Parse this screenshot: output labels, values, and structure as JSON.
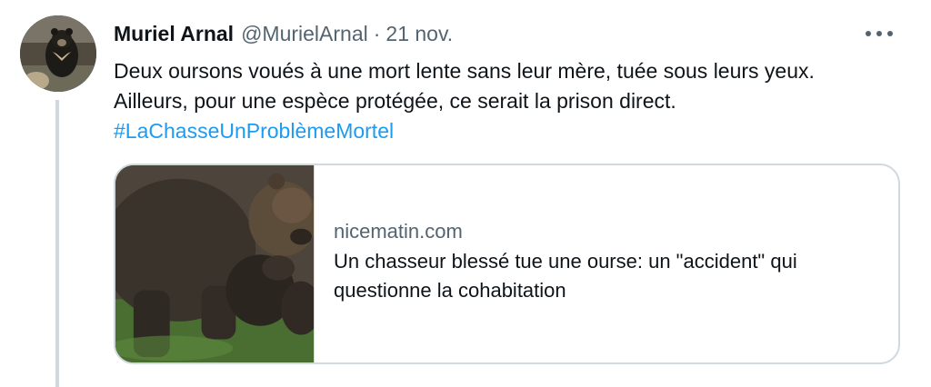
{
  "tweet": {
    "author_name": "Muriel Arnal",
    "handle": "@MurielArnal",
    "separator": "·",
    "date": "21 nov.",
    "text_line_1": "Deux oursons voués à une mort lente sans leur mère, tuée sous leurs yeux.",
    "text_line_2": "Ailleurs, pour une espèce protégée, ce serait la prison direct.",
    "hashtag": "#LaChasseUnProblèmeMortel",
    "more_icon": "more-horizontal-icon"
  },
  "card": {
    "domain": "nicematin.com",
    "title": "Un chasseur blessé tue une ourse: un \"accident\" qui questionne la cohabitation"
  },
  "colors": {
    "text": "#0f1419",
    "secondary": "#536471",
    "link": "#1d9bf0",
    "border": "#cfd9de"
  }
}
